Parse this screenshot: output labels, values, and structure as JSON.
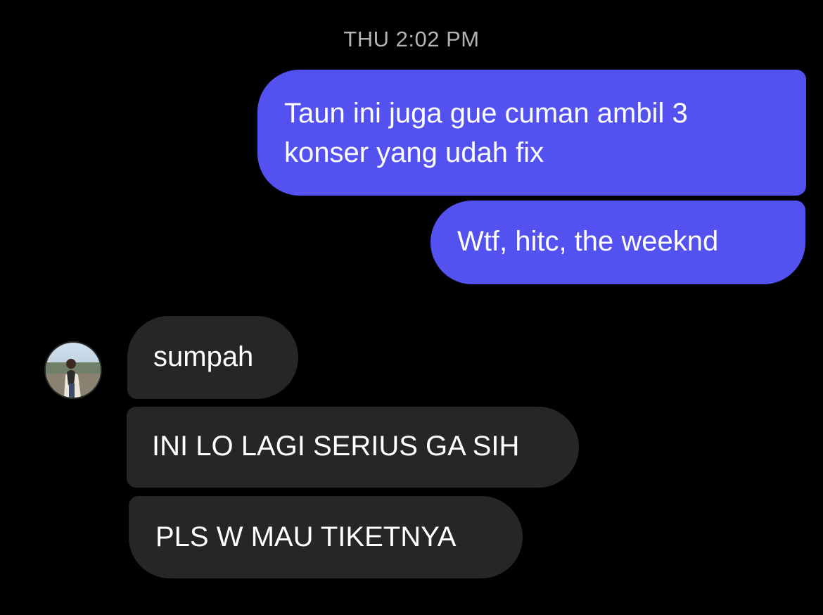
{
  "conversation": {
    "timestamp": "THU 2:02 PM",
    "sent_messages": [
      {
        "line1": "Taun ini juga gue cuman ambil 3",
        "line2": "konser yang udah fix"
      },
      {
        "text": "Wtf, hitc, the weeknd"
      }
    ],
    "received_messages": [
      {
        "text": "sumpah"
      },
      {
        "text": "INI LO LAGI SERIUS GA SIH"
      },
      {
        "text": "PLS W MAU TIKETNYA"
      }
    ]
  },
  "colors": {
    "background": "#000000",
    "sent_bubble": "#5351f0",
    "received_bubble": "#262626",
    "timestamp_text": "#b3b3b3",
    "message_text": "#ffffff"
  },
  "icons": {
    "avatar": "contact-avatar-photo"
  }
}
